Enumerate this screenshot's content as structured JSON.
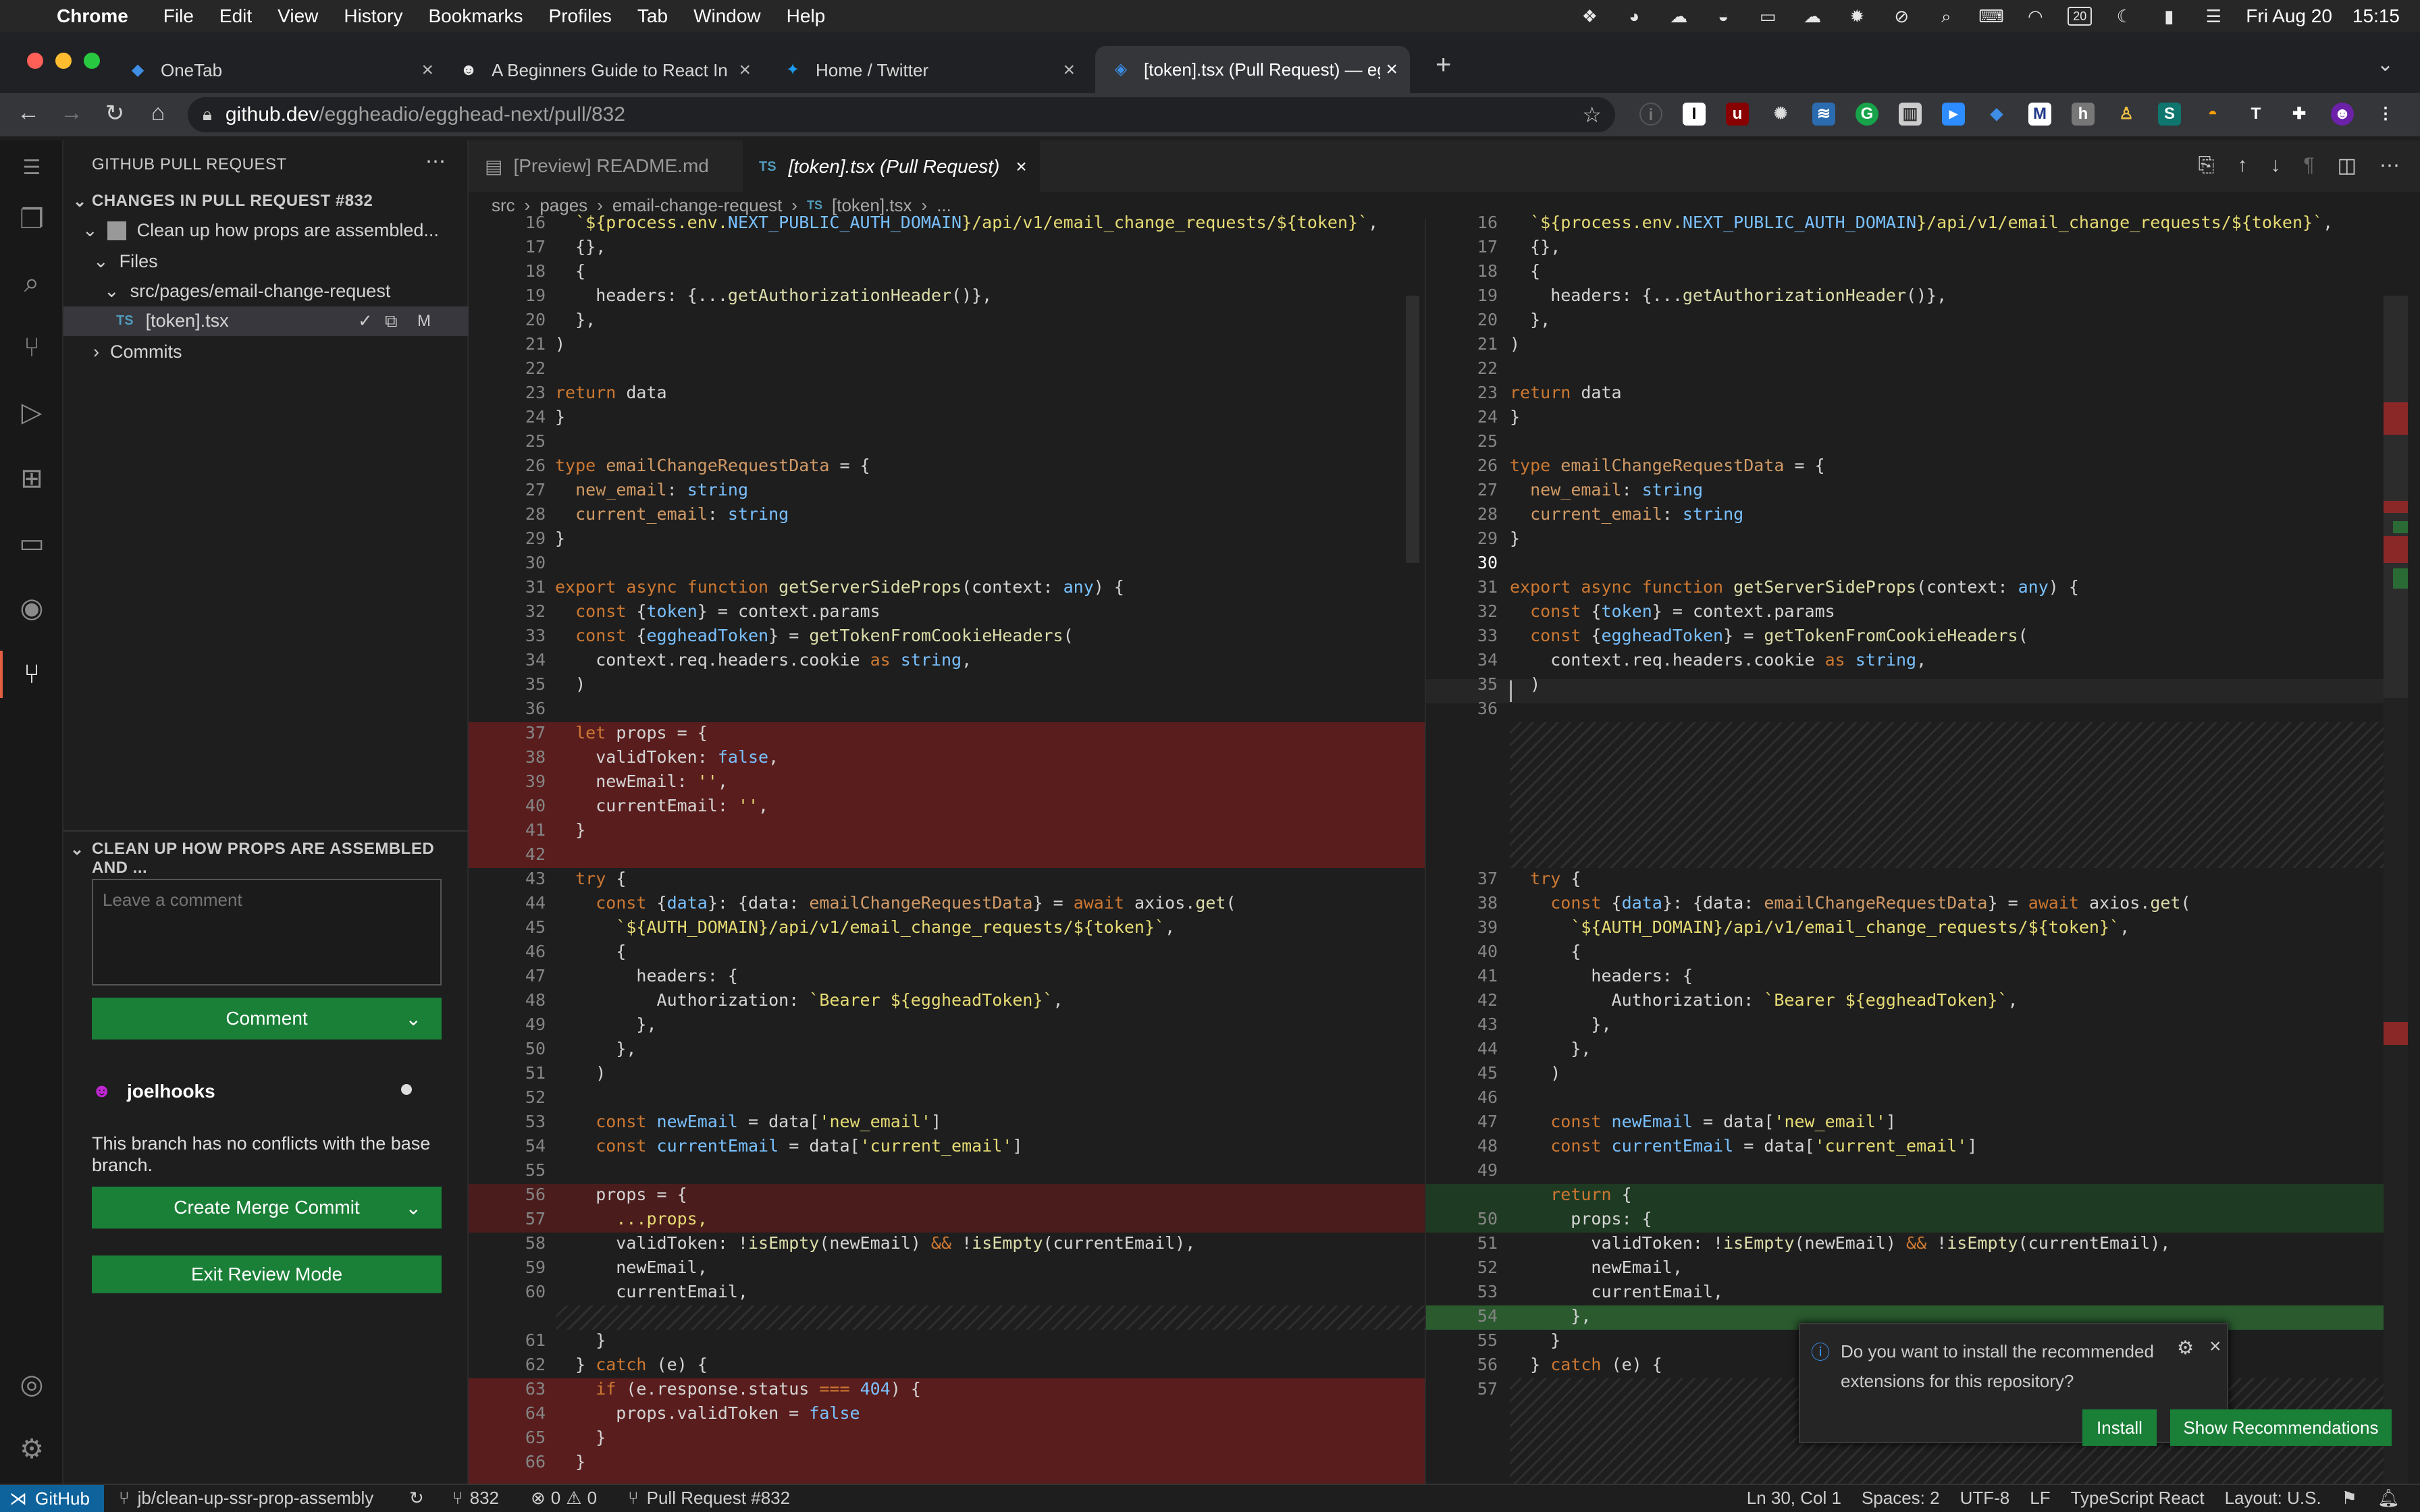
{
  "menubar": {
    "apple_icon": "apple-icon",
    "app": "Chrome",
    "items": [
      "File",
      "Edit",
      "View",
      "History",
      "Bookmarks",
      "Profiles",
      "Tab",
      "Window",
      "Help"
    ],
    "date": "Fri Aug 20",
    "time": "15:15",
    "calendar_day": "20"
  },
  "tabs": [
    {
      "title": "OneTab",
      "icon": "onetab-icon"
    },
    {
      "title": "A Beginners Guide to React Int",
      "icon": "egghead-icon"
    },
    {
      "title": "Home / Twitter",
      "icon": "twitter-icon"
    },
    {
      "title": "[token].tsx (Pull Request) — eg",
      "icon": "vscode-icon"
    }
  ],
  "address": {
    "url_host": "github.dev",
    "url_path": "/eggheadio/egghead-next/pull/832"
  },
  "sidebar": {
    "title": "GITHUB PULL REQUEST",
    "section": "CHANGES IN PULL REQUEST #832",
    "pr_title": "Clean up how props are assembled...",
    "files_label": "Files",
    "folder": "src/pages/email-change-request",
    "file": "[token].tsx",
    "file_lang": "TS",
    "file_status": "M",
    "commits_label": "Commits",
    "review_section": "CLEAN UP HOW PROPS ARE ASSEMBLED AND ...",
    "comment_placeholder": "Leave a comment",
    "comment_button": "Comment",
    "user": "joelhooks",
    "merge_message": "This branch has no conflicts with the base branch.",
    "merge_button": "Create Merge Commit",
    "exit_button": "Exit Review Mode"
  },
  "editor": {
    "tabs": [
      {
        "label": "[Preview] README.md"
      },
      {
        "label": "[token].tsx (Pull Request)",
        "lang": "TS"
      }
    ],
    "breadcrumb": [
      "src",
      "pages",
      "email-change-request",
      "[token].tsx",
      "..."
    ],
    "left_numbers": [
      "16",
      "17",
      "18",
      "19",
      "20",
      "21",
      "22",
      "23",
      "24",
      "25",
      "26",
      "27",
      "28",
      "29",
      "30",
      "31",
      "32",
      "33",
      "34",
      "35",
      "36",
      "37",
      "38",
      "39",
      "40",
      "41",
      "42",
      "43",
      "44",
      "45",
      "46",
      "47",
      "48",
      "49",
      "50",
      "51",
      "52",
      "53",
      "54",
      "55",
      "56",
      "57",
      "58",
      "59",
      "60",
      "61",
      "62",
      "63",
      "64",
      "65",
      "66"
    ],
    "right_numbers": [
      "16",
      "17",
      "18",
      "19",
      "20",
      "21",
      "22",
      "23",
      "24",
      "25",
      "26",
      "27",
      "28",
      "29",
      "30",
      "31",
      "32",
      "33",
      "34",
      "35",
      "36",
      "37",
      "38",
      "39",
      "40",
      "41",
      "42",
      "43",
      "44",
      "45",
      "46",
      "47",
      "48",
      "49",
      "50",
      "51",
      "52",
      "53",
      "54",
      "55",
      "56",
      "57"
    ]
  },
  "notification": {
    "message": "Do you want to install the recommended extensions for this repository?",
    "install": "Install",
    "show": "Show Recommendations"
  },
  "status": {
    "remote": "GitHub",
    "branch": "jb/clean-up-ssr-prop-assembly",
    "pr_count": "832",
    "errors": "0",
    "warnings": "0",
    "pr": "Pull Request #832",
    "position": "Ln 30, Col 1",
    "spaces": "Spaces: 2",
    "encoding": "UTF-8",
    "eol": "LF",
    "language": "TypeScript React",
    "layout": "Layout: U.S."
  },
  "colors": {
    "removed_bg": "#5a1d1d",
    "added_bg": "#1f3a22",
    "accent_green": "#1a7f37"
  }
}
